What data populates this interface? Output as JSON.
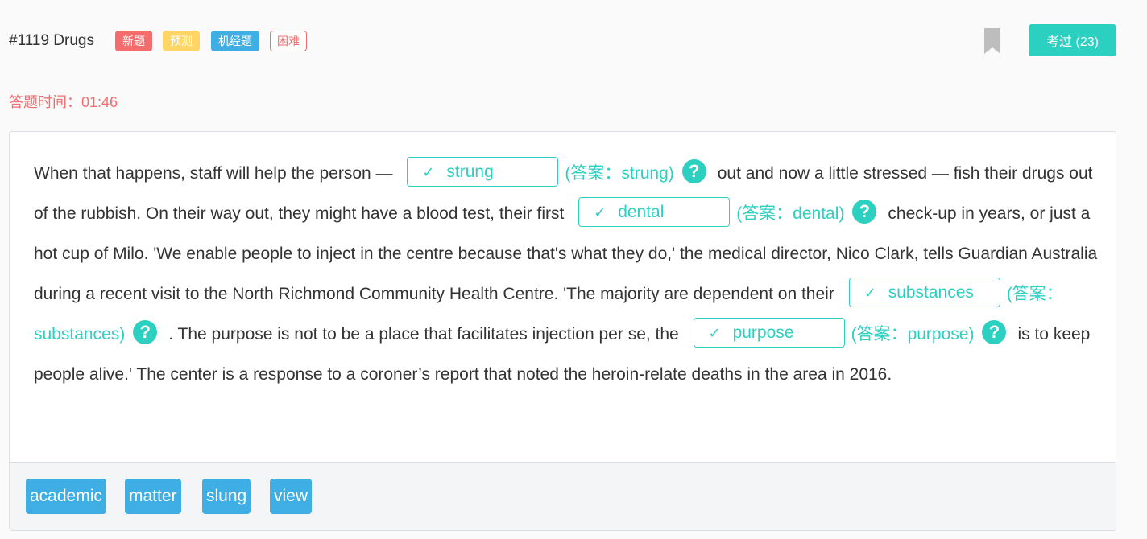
{
  "header": {
    "question_title": "#1119 Drugs",
    "tags": {
      "new": "新题",
      "prediction": "预测",
      "machine": "机经题",
      "difficulty": "困难"
    },
    "passed_button": "考过 (23)"
  },
  "timer": {
    "label": "答题时间：",
    "value": "01:46"
  },
  "passage": {
    "s1": "When that happens, staff will help the person —",
    "b1": {
      "value": "strung",
      "answer": "(答案：strung)"
    },
    "s2": "out and now a little stressed — fish their drugs out of the rubbish. On their way out, they might have a blood test, their first",
    "b2": {
      "value": "dental",
      "answer": "(答案：dental)"
    },
    "s3": "check-up in years, or just a hot cup of Milo. 'We enable people to inject in the centre because that's what they do,' the medical director, Nico Clark, tells Guardian Australia during a recent visit to the North Richmond Community Health Centre. 'The majority are dependent on their",
    "b3": {
      "value": "substances",
      "answer": "(答案：substances)"
    },
    "s4": ". The purpose is not to be a place that facilitates injection per se, the",
    "b4": {
      "value": "purpose",
      "answer": "(答案：purpose)"
    },
    "s5": "is to keep people alive.' The center is a response to a coroner’s report that noted the heroin-relate deaths in the area in 2016."
  },
  "word_bank": [
    "academic",
    "matter",
    "slung",
    "view"
  ],
  "icons": {
    "check": "check-icon",
    "help": "question-circle-icon",
    "bookmark": "bookmark-icon"
  },
  "colors": {
    "accent": "#2cd0c0",
    "danger": "#f56c6c",
    "word": "#3eaee4"
  }
}
